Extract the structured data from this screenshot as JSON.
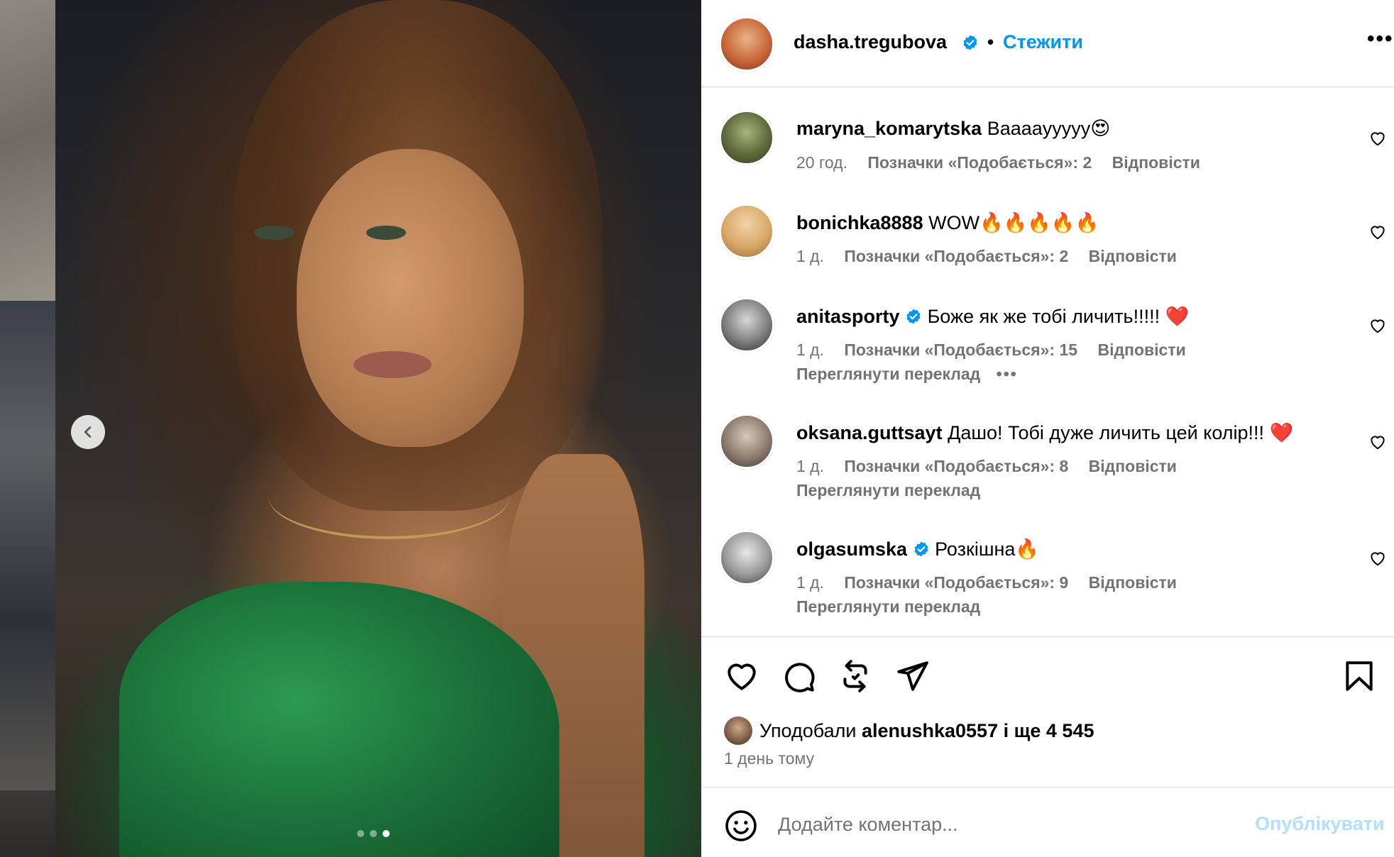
{
  "post": {
    "author": "dasha.tregubova",
    "follow_label": "Стежити",
    "separator": "•",
    "more_label": "•••",
    "carousel": {
      "total": 3,
      "active_index": 3
    }
  },
  "comments": [
    {
      "username": "maryna_komarytska",
      "verified": false,
      "text": "Baaaayyyyy😍",
      "time": "20 год.",
      "likes": "Позначки «Подобається»: 2",
      "reply": "Відповісти"
    },
    {
      "username": "bonichka8888",
      "verified": false,
      "text": "WOW🔥🔥🔥🔥🔥",
      "time": "1 д.",
      "likes": "Позначки «Подобається»: 2",
      "reply": "Відповісти"
    },
    {
      "username": "anitasporty",
      "verified": true,
      "text": "Боже як же тобі личить!!!!! ❤️",
      "time": "1 д.",
      "likes": "Позначки «Подобається»: 15",
      "reply": "Відповісти",
      "translate": "Переглянути переклад",
      "extra": "•••"
    },
    {
      "username": "oksana.guttsayt",
      "verified": false,
      "text": "Дашо! Тобі дуже личить цей колір!!! ❤️",
      "time": "1 д.",
      "likes": "Позначки «Подобається»: 8",
      "reply": "Відповісти",
      "translate": "Переглянути переклад"
    },
    {
      "username": "olgasumska",
      "verified": true,
      "text": "Розкішна🔥",
      "time": "1 д.",
      "likes": "Позначки «Подобається»: 9",
      "reply": "Відповісти",
      "translate": "Переглянути переклад"
    }
  ],
  "likes_summary": {
    "prefix": "Уподобали",
    "user": "alenushka0557",
    "rest": "і ще 4 545"
  },
  "time_ago": "1 день тому",
  "composer": {
    "placeholder": "Додайте коментар...",
    "publish_label": "Опублікувати"
  },
  "icons": {
    "prev": "chevron-left-icon",
    "like": "heart-icon",
    "comment": "comment-icon",
    "repost": "repost-icon",
    "share": "send-icon",
    "save": "bookmark-icon",
    "emoji": "emoji-icon",
    "verified": "verified-badge-icon"
  },
  "colors": {
    "accent": "#0095f6",
    "publish_disabled": "#b2dffc",
    "muted": "#737373",
    "verified": "#0095f6"
  }
}
